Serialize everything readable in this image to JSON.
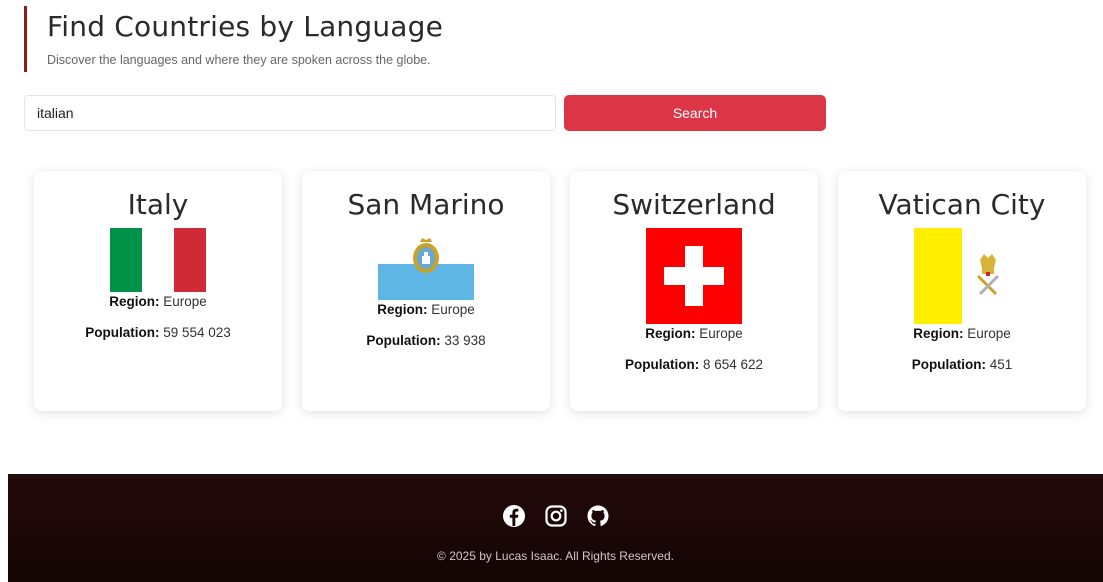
{
  "header": {
    "title": "Find Countries by Language",
    "subtitle": "Discover the languages and where they are spoken across the globe."
  },
  "search": {
    "value": "italian",
    "button_label": "Search"
  },
  "labels": {
    "region": "Region:",
    "population": "Population:"
  },
  "countries": [
    {
      "name": "Italy",
      "region": "Europe",
      "population": "59 554 023"
    },
    {
      "name": "San Marino",
      "region": "Europe",
      "population": "33 938"
    },
    {
      "name": "Switzerland",
      "region": "Europe",
      "population": "8 654 622"
    },
    {
      "name": "Vatican City",
      "region": "Europe",
      "population": "451"
    }
  ],
  "footer": {
    "icons": [
      "facebook-icon",
      "instagram-icon",
      "github-icon"
    ],
    "copyright": "© 2025 by Lucas Isaac. All Rights Reserved."
  },
  "colors": {
    "accent": "#dc3545",
    "header_border": "#8a1c1c",
    "footer_bg": "#1c0707"
  }
}
